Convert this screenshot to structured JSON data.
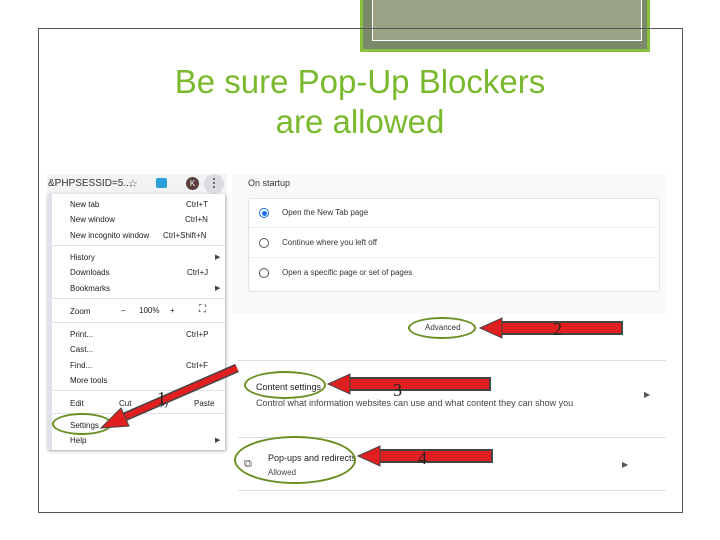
{
  "slide": {
    "title_line1": "Be sure Pop-Up Blockers",
    "title_line2": "are allowed",
    "title_color": "#7ab92e",
    "accent_border": "#8bbf3f"
  },
  "browser": {
    "url_fragment": "&PHPSESSID=5...",
    "avatar_letter": "K",
    "icons": [
      "star-icon",
      "extension-icon",
      "avatar",
      "kebab-menu-icon"
    ]
  },
  "menu": {
    "items": [
      {
        "label": "New tab",
        "shortcut": "Ctrl+T"
      },
      {
        "label": "New window",
        "shortcut": "Ctrl+N"
      },
      {
        "label": "New incognito window",
        "shortcut": "Ctrl+Shift+N"
      },
      {
        "label": "History",
        "shortcut": ""
      },
      {
        "label": "Downloads",
        "shortcut": "Ctrl+J"
      },
      {
        "label": "Bookmarks",
        "shortcut": ""
      },
      {
        "label": "Zoom",
        "shortcut": ""
      },
      {
        "label": "Print...",
        "shortcut": "Ctrl+P"
      },
      {
        "label": "Cast...",
        "shortcut": ""
      },
      {
        "label": "Find...",
        "shortcut": "Ctrl+F"
      },
      {
        "label": "More tools",
        "shortcut": ""
      },
      {
        "label": "Edit",
        "shortcut": ""
      },
      {
        "label": "Settings",
        "shortcut": ""
      },
      {
        "label": "Help",
        "shortcut": ""
      }
    ],
    "zoom": {
      "minus": "–",
      "level": "100%",
      "plus": "+",
      "fullscreen": "⛶"
    },
    "edit": {
      "cut": "Cut",
      "copy": "Copy",
      "paste": "Paste"
    }
  },
  "settings": {
    "on_startup": "On startup",
    "options": [
      {
        "label": "Open the New Tab page",
        "selected": true
      },
      {
        "label": "Continue where you left off",
        "selected": false
      },
      {
        "label": "Open a specific page or set of pages",
        "selected": false
      }
    ],
    "advanced": "Advanced",
    "content_settings": "Content settings",
    "content_desc": "Control what information websites can use and what content they can show you",
    "popups_label": "Pop-ups and redirects",
    "popups_value": "Allowed"
  },
  "annotations": {
    "step1": "1",
    "step2": "2",
    "step3": "3",
    "step4": "4",
    "arrow_color": "#e02020",
    "ellipse_color": "#6b8e23"
  }
}
